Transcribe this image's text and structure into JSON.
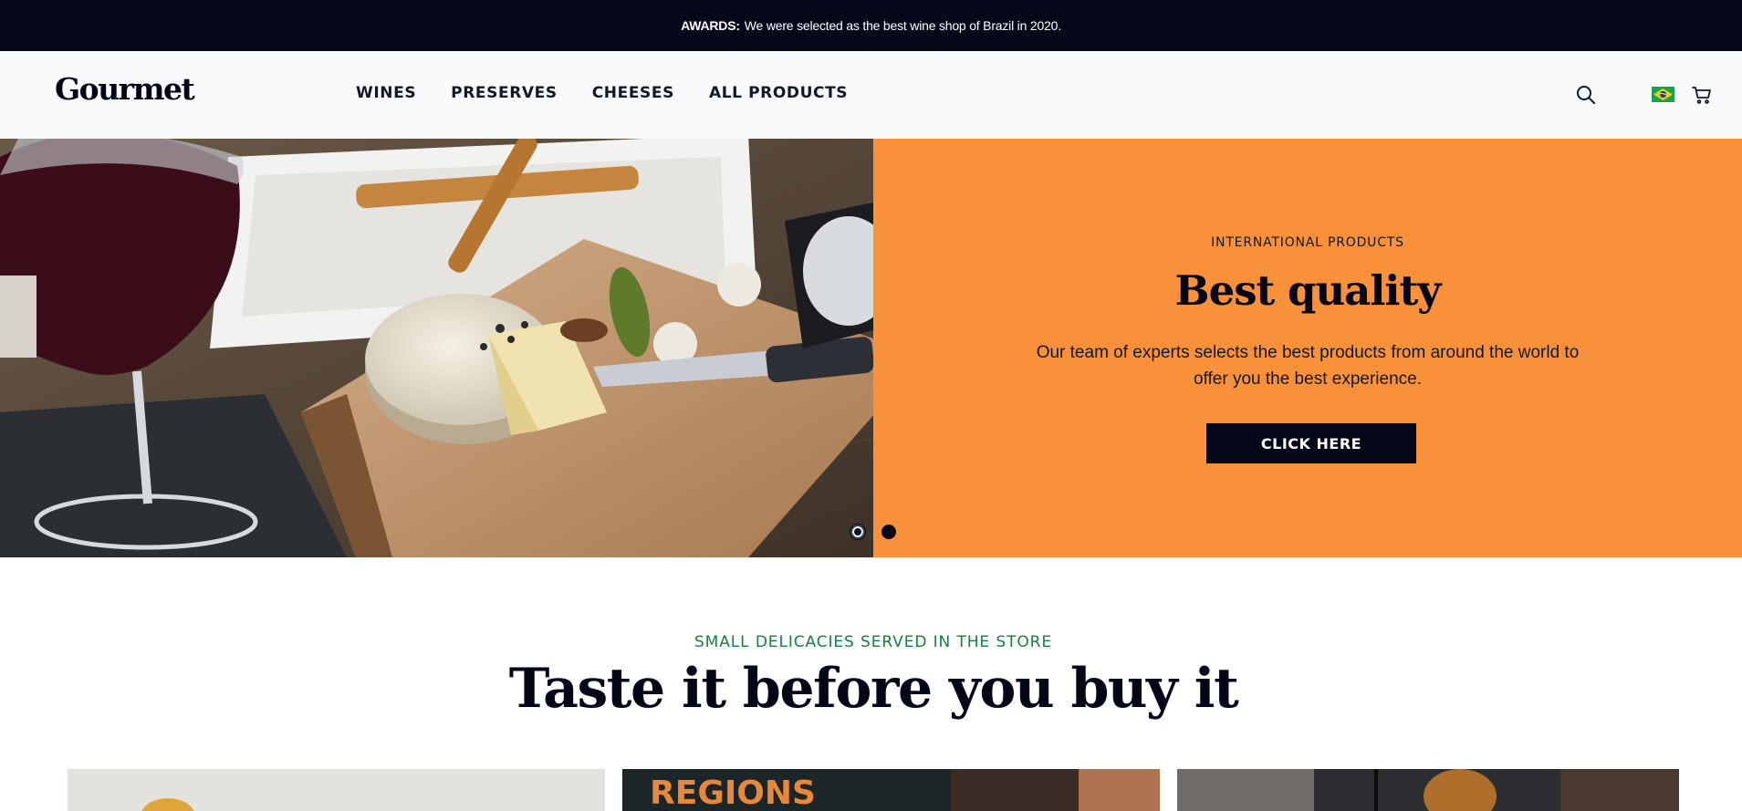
{
  "announcement": {
    "label": "AWARDS:",
    "text": "We were selected as the best wine shop of Brazil in 2020."
  },
  "header": {
    "logo": "Gourmet",
    "nav": [
      {
        "label": "WINES"
      },
      {
        "label": "PRESERVES"
      },
      {
        "label": "CHEESES"
      },
      {
        "label": "ALL PRODUCTS"
      }
    ],
    "icons": {
      "search": "search-icon",
      "flag": "brazil-flag-icon",
      "cart": "cart-icon"
    }
  },
  "hero": {
    "eyebrow": "INTERNATIONAL PRODUCTS",
    "title": "Best quality",
    "text": "Our team of experts selects the best products from around the world to offer you the best experience.",
    "cta": "CLICK HERE",
    "slides": 2,
    "active_slide": 1
  },
  "section": {
    "eyebrow": "SMALL DELICACIES SERVED IN THE STORE",
    "title": "Taste it before you buy it",
    "card2_sign": "REGIONS"
  },
  "colors": {
    "topbar": "#050819",
    "hero_panel": "#f9913a",
    "accent_green": "#15803d",
    "button": "#050819"
  }
}
